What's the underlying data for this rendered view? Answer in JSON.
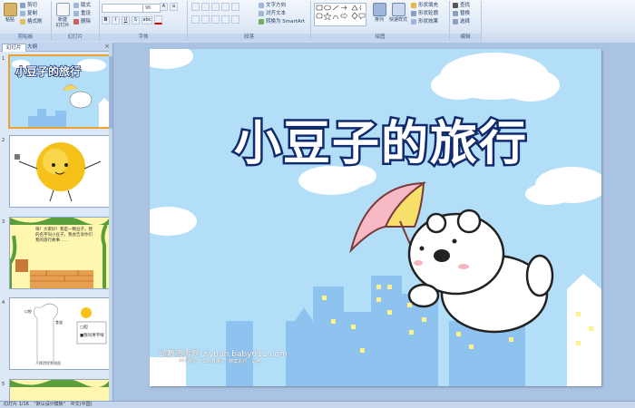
{
  "ribbon": {
    "clipboard": {
      "paste": "粘贴",
      "cut": "剪切",
      "copy": "复制",
      "format_painter": "格式刷",
      "label": "剪贴板"
    },
    "slides": {
      "new_slide": "新建\n幻灯片",
      "layout": "版式",
      "reset": "重设",
      "delete": "删除",
      "label": "幻灯片"
    },
    "font": {
      "font_name": "",
      "font_size": "96",
      "bold": "B",
      "italic": "I",
      "underline": "U",
      "shadow": "S",
      "strike": "abc",
      "label": "字体"
    },
    "paragraph": {
      "text_direction": "文字方向",
      "align_text": "对齐文本",
      "smartart": "转换为 SmartArt",
      "label": "段落"
    },
    "drawing": {
      "arrange": "排列",
      "quick_styles": "快速样式",
      "shape_fill": "形状填充",
      "shape_outline": "形状轮廓",
      "shape_effects": "形状效果",
      "label": "绘图"
    },
    "editing": {
      "find": "查找",
      "replace": "替换",
      "select": "选择",
      "label": "编辑"
    }
  },
  "panel": {
    "tab_slides": "幻灯片",
    "tab_outline": "大纲",
    "close": "×",
    "slide_numbers": [
      "1",
      "2",
      "3",
      "4",
      "5"
    ]
  },
  "slide": {
    "title": "小豆子的旅行",
    "watermark": "幼教资源网 ziyuan.baby611.com",
    "watermark_sub": "PPT课件、FLASH课件、教案素材、试卷",
    "thumb1_title": "小豆子的旅行"
  },
  "thumbs": {
    "slide3_text": "嗨！大家好！我是一颗豆子。我的名字叫小豆子。我会告诉你们我的旅行故事……",
    "slide4_label1": "口腔",
    "slide4_label2": "食道",
    "slide4_box1": "□胆",
    "slide4_box2": "■我叫胃字嗦",
    "slide4_caption": "人体消化系统图"
  },
  "status": {
    "slide_count": "幻灯片 1/16",
    "theme": "\"默认设计模板\"",
    "language": "中文(中国)"
  },
  "colors": {
    "accent": "#f0a030",
    "title_outline": "#102a6e",
    "sky": "#b3def8",
    "building": "#8fc3ef"
  }
}
